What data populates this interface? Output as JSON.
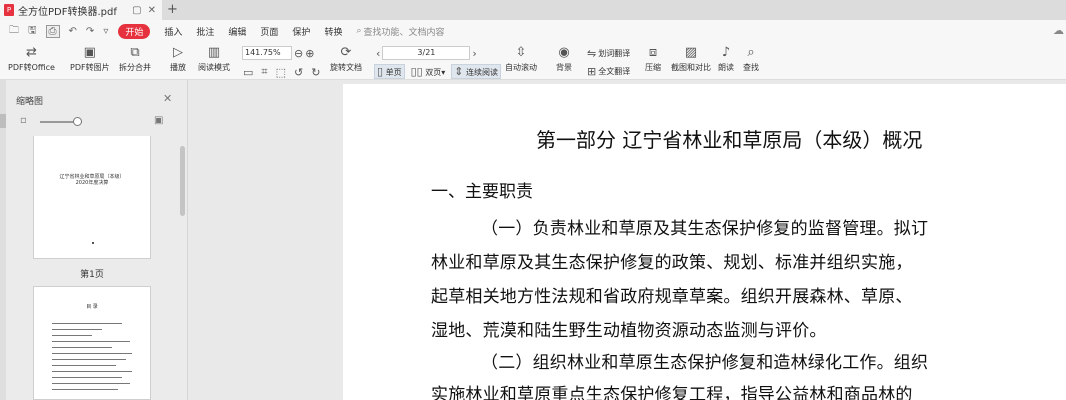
{
  "tab": {
    "logo": "P",
    "title": "全方位PDF转换器.pdf",
    "controls": [
      "▢",
      "✕"
    ],
    "add": "+"
  },
  "menubar": {
    "quick_icons": [
      "open-icon",
      "save-icon",
      "print-icon",
      "undo-icon",
      "redo-icon",
      "dropdown-icon"
    ],
    "start": "开始",
    "items": [
      "插入",
      "批注",
      "编辑",
      "页面",
      "保护",
      "转换"
    ],
    "search_placeholder": "查找功能、文档内容"
  },
  "toolbar": {
    "pdf_to_office": "PDF转Office",
    "pdf_to_image": "PDF转图片",
    "split_merge": "拆分合并",
    "play": "播放",
    "read_mode": "阅读模式",
    "zoom_value": "141.75%",
    "page_value": "3/21",
    "rotate_doc": "旋转文档",
    "single_page": "单页",
    "double_page": "双页",
    "continuous": "连续阅读",
    "auto_scroll": "自动滚动",
    "background": "背景",
    "word_translate": "划词翻译",
    "full_translate": "全文翻译",
    "compress": "压缩",
    "screenshot_compare": "截图和对比",
    "read_aloud": "朗读",
    "find": "查找"
  },
  "thumbnail_pane": {
    "title": "缩略图",
    "page1_label": "第1页",
    "page1_text": "辽宁省林业和草原局（本级）\n2020年度决算",
    "page2_heading": "目 录"
  },
  "document": {
    "title": "第一部分  辽宁省林业和草原局（本级）概况",
    "section": "一、主要职责",
    "lines": [
      "（一）负责林业和草原及其生态保护修复的监督管理。拟订",
      "林业和草原及其生态保护修复的政策、规划、标准并组织实施，",
      "起草相关地方性法规和省政府规章草案。组织开展森林、草原、",
      "湿地、荒漠和陆生野生动植物资源动态监测与评价。",
      "（二）组织林业和草原生态保护修复和造林绿化工作。组织",
      "实施林业和草原重点生态保护修复工程，指导公益林和商品林的"
    ]
  },
  "colors": {
    "accent": "#e5323e",
    "page_bg": "#ffffff",
    "chrome_bg": "#f7f7f7"
  }
}
